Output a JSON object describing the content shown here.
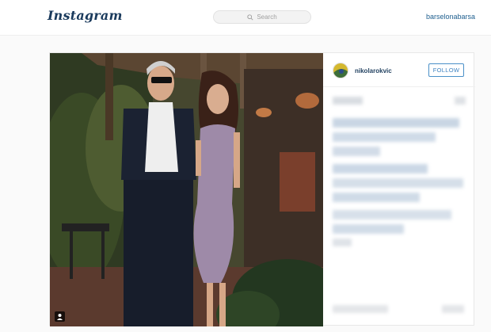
{
  "header": {
    "logo_text": "Instagram",
    "search_placeholder": "Search",
    "logged_in_user": "barselonabarsa"
  },
  "post": {
    "author": "nikolarokvic",
    "follow_label": "FOLLOW",
    "tag_icon": "person-tag-icon"
  },
  "colors": {
    "brand_blue": "#1f5f8f",
    "follow_blue": "#3f83c1",
    "page_bg": "#fafafa"
  }
}
